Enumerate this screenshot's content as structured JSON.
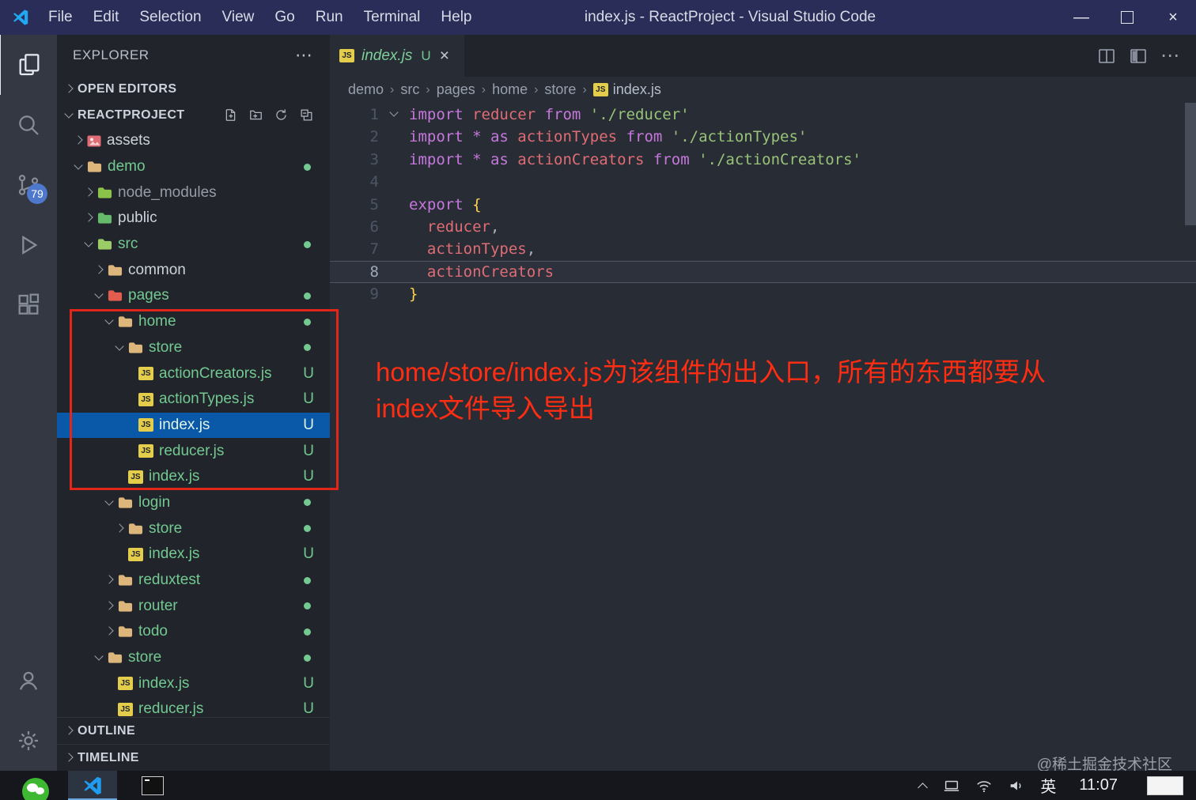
{
  "colors": {
    "titlebar": "#292d58",
    "activitybar": "#333842",
    "sidebar": "#21252b",
    "editor": "#282c34",
    "selection_blue": "#0a59a8",
    "git_untracked_green": "#73c991",
    "annotation_red": "#ff2d12",
    "annotation_box_red": "#e2261a",
    "badge_blue": "#4d78cc",
    "js_icon_yellow": "#e3cd4b"
  },
  "icons": {
    "js_badge": "JS",
    "close": "×",
    "minimize": "—",
    "more": "⋯",
    "crumb_sep": "›"
  },
  "title_bar": {
    "menus": [
      "File",
      "Edit",
      "Selection",
      "View",
      "Go",
      "Run",
      "Terminal",
      "Help"
    ],
    "title": "index.js - ReactProject - Visual Studio Code"
  },
  "activity_bar": {
    "source_control_badge": "79"
  },
  "sidebar": {
    "title": "EXPLORER",
    "open_editors_label": "OPEN EDITORS",
    "project_label": "REACTPROJECT",
    "outline_label": "OUTLINE",
    "timeline_label": "TIMELINE",
    "tree": [
      {
        "label": "assets",
        "level": 1,
        "chevron": "right",
        "icon": "assets",
        "color": "default"
      },
      {
        "label": "demo",
        "level": 1,
        "chevron": "down",
        "icon": "folder",
        "folder_color": "#dcb67a",
        "color": "green",
        "dot": true
      },
      {
        "label": "node_modules",
        "level": 2,
        "chevron": "right",
        "icon": "folder",
        "folder_color": "#8bc34a",
        "color": "dim"
      },
      {
        "label": "public",
        "level": 2,
        "chevron": "right",
        "icon": "folder",
        "folder_color": "#66bb6a",
        "color": "default"
      },
      {
        "label": "src",
        "level": 2,
        "chevron": "down",
        "icon": "folder",
        "folder_color": "#9ccc65",
        "color": "green",
        "dot": true
      },
      {
        "label": "common",
        "level": 3,
        "chevron": "right",
        "icon": "folder",
        "folder_color": "#dcb67a",
        "color": "default"
      },
      {
        "label": "pages",
        "level": 3,
        "chevron": "down",
        "icon": "folder",
        "folder_color": "#e35d4f",
        "color": "green",
        "dot": true
      },
      {
        "label": "home",
        "level": 4,
        "chevron": "down",
        "icon": "folder",
        "folder_color": "#dcb67a",
        "color": "green",
        "dot": true
      },
      {
        "label": "store",
        "level": 5,
        "chevron": "down",
        "icon": "folder",
        "folder_color": "#dcb67a",
        "color": "green",
        "dot": true
      },
      {
        "label": "actionCreators.js",
        "level": 6,
        "chevron": "none",
        "icon": "js",
        "color": "green",
        "badge": "U"
      },
      {
        "label": "actionTypes.js",
        "level": 6,
        "chevron": "none",
        "icon": "js",
        "color": "green",
        "badge": "U"
      },
      {
        "label": "index.js",
        "level": 6,
        "chevron": "none",
        "icon": "js",
        "color": "green",
        "badge": "U",
        "selected": true
      },
      {
        "label": "reducer.js",
        "level": 6,
        "chevron": "none",
        "icon": "js",
        "color": "green",
        "badge": "U"
      },
      {
        "label": "index.js",
        "level": 5,
        "chevron": "none",
        "icon": "js",
        "color": "green",
        "badge": "U"
      },
      {
        "label": "login",
        "level": 4,
        "chevron": "down",
        "icon": "folder",
        "folder_color": "#dcb67a",
        "color": "green",
        "dot": true
      },
      {
        "label": "store",
        "level": 5,
        "chevron": "right",
        "icon": "folder",
        "folder_color": "#dcb67a",
        "color": "green",
        "dot": true
      },
      {
        "label": "index.js",
        "level": 5,
        "chevron": "none",
        "icon": "js",
        "color": "green",
        "badge": "U"
      },
      {
        "label": "reduxtest",
        "level": 4,
        "chevron": "right",
        "icon": "folder",
        "folder_color": "#dcb67a",
        "color": "green",
        "dot": true
      },
      {
        "label": "router",
        "level": 4,
        "chevron": "right",
        "icon": "folder",
        "folder_color": "#dcb67a",
        "color": "green",
        "dot": true
      },
      {
        "label": "todo",
        "level": 4,
        "chevron": "right",
        "icon": "folder",
        "folder_color": "#dcb67a",
        "color": "green",
        "dot": true
      },
      {
        "label": "store",
        "level": 3,
        "chevron": "down",
        "icon": "folder",
        "folder_color": "#dcb67a",
        "color": "green",
        "dot": true
      },
      {
        "label": "index.js",
        "level": 4,
        "chevron": "none",
        "icon": "js",
        "color": "green",
        "badge": "U"
      },
      {
        "label": "reducer.js",
        "level": 4,
        "chevron": "none",
        "icon": "js",
        "color": "green",
        "badge": "U"
      }
    ]
  },
  "editor": {
    "tab": {
      "label": "index.js",
      "badge": "U"
    },
    "breadcrumb": [
      "demo",
      "src",
      "pages",
      "home",
      "store"
    ],
    "breadcrumb_file": "index.js",
    "code": [
      {
        "n": "1",
        "fold": true,
        "tokens": [
          {
            "t": "import ",
            "c": "kw"
          },
          {
            "t": "reducer ",
            "c": "id"
          },
          {
            "t": "from ",
            "c": "kw"
          },
          {
            "t": "'./reducer'",
            "c": "str"
          }
        ]
      },
      {
        "n": "2",
        "tokens": [
          {
            "t": "import ",
            "c": "kw"
          },
          {
            "t": "* ",
            "c": "kw"
          },
          {
            "t": "as ",
            "c": "kw"
          },
          {
            "t": "actionTypes ",
            "c": "id"
          },
          {
            "t": "from ",
            "c": "kw"
          },
          {
            "t": "'./actionTypes'",
            "c": "str"
          }
        ]
      },
      {
        "n": "3",
        "tokens": [
          {
            "t": "import ",
            "c": "kw"
          },
          {
            "t": "* ",
            "c": "kw"
          },
          {
            "t": "as ",
            "c": "kw"
          },
          {
            "t": "actionCreators ",
            "c": "id"
          },
          {
            "t": "from ",
            "c": "kw"
          },
          {
            "t": "'./actionCreators'",
            "c": "str"
          }
        ]
      },
      {
        "n": "4",
        "tokens": []
      },
      {
        "n": "5",
        "tokens": [
          {
            "t": "export ",
            "c": "kw"
          },
          {
            "t": "{",
            "c": "brace"
          }
        ]
      },
      {
        "n": "6",
        "tokens": [
          {
            "t": "  ",
            "c": "plain"
          },
          {
            "t": "reducer",
            "c": "id"
          },
          {
            "t": ",",
            "c": "plain"
          }
        ]
      },
      {
        "n": "7",
        "tokens": [
          {
            "t": "  ",
            "c": "plain"
          },
          {
            "t": "actionTypes",
            "c": "id"
          },
          {
            "t": ",",
            "c": "plain"
          }
        ]
      },
      {
        "n": "8",
        "active": true,
        "tokens": [
          {
            "t": "  ",
            "c": "plain"
          },
          {
            "t": "actionCreators",
            "c": "id"
          }
        ]
      },
      {
        "n": "9",
        "tokens": [
          {
            "t": "}",
            "c": "brace"
          }
        ]
      }
    ],
    "annotation": {
      "line1": "home/store/index.js为该组件的出入口，所有的东西都要从",
      "line2": "index文件导入导出"
    }
  },
  "taskbar": {
    "time": "11:07",
    "ime": "英",
    "watermark": "@稀土掘金技术社区"
  }
}
